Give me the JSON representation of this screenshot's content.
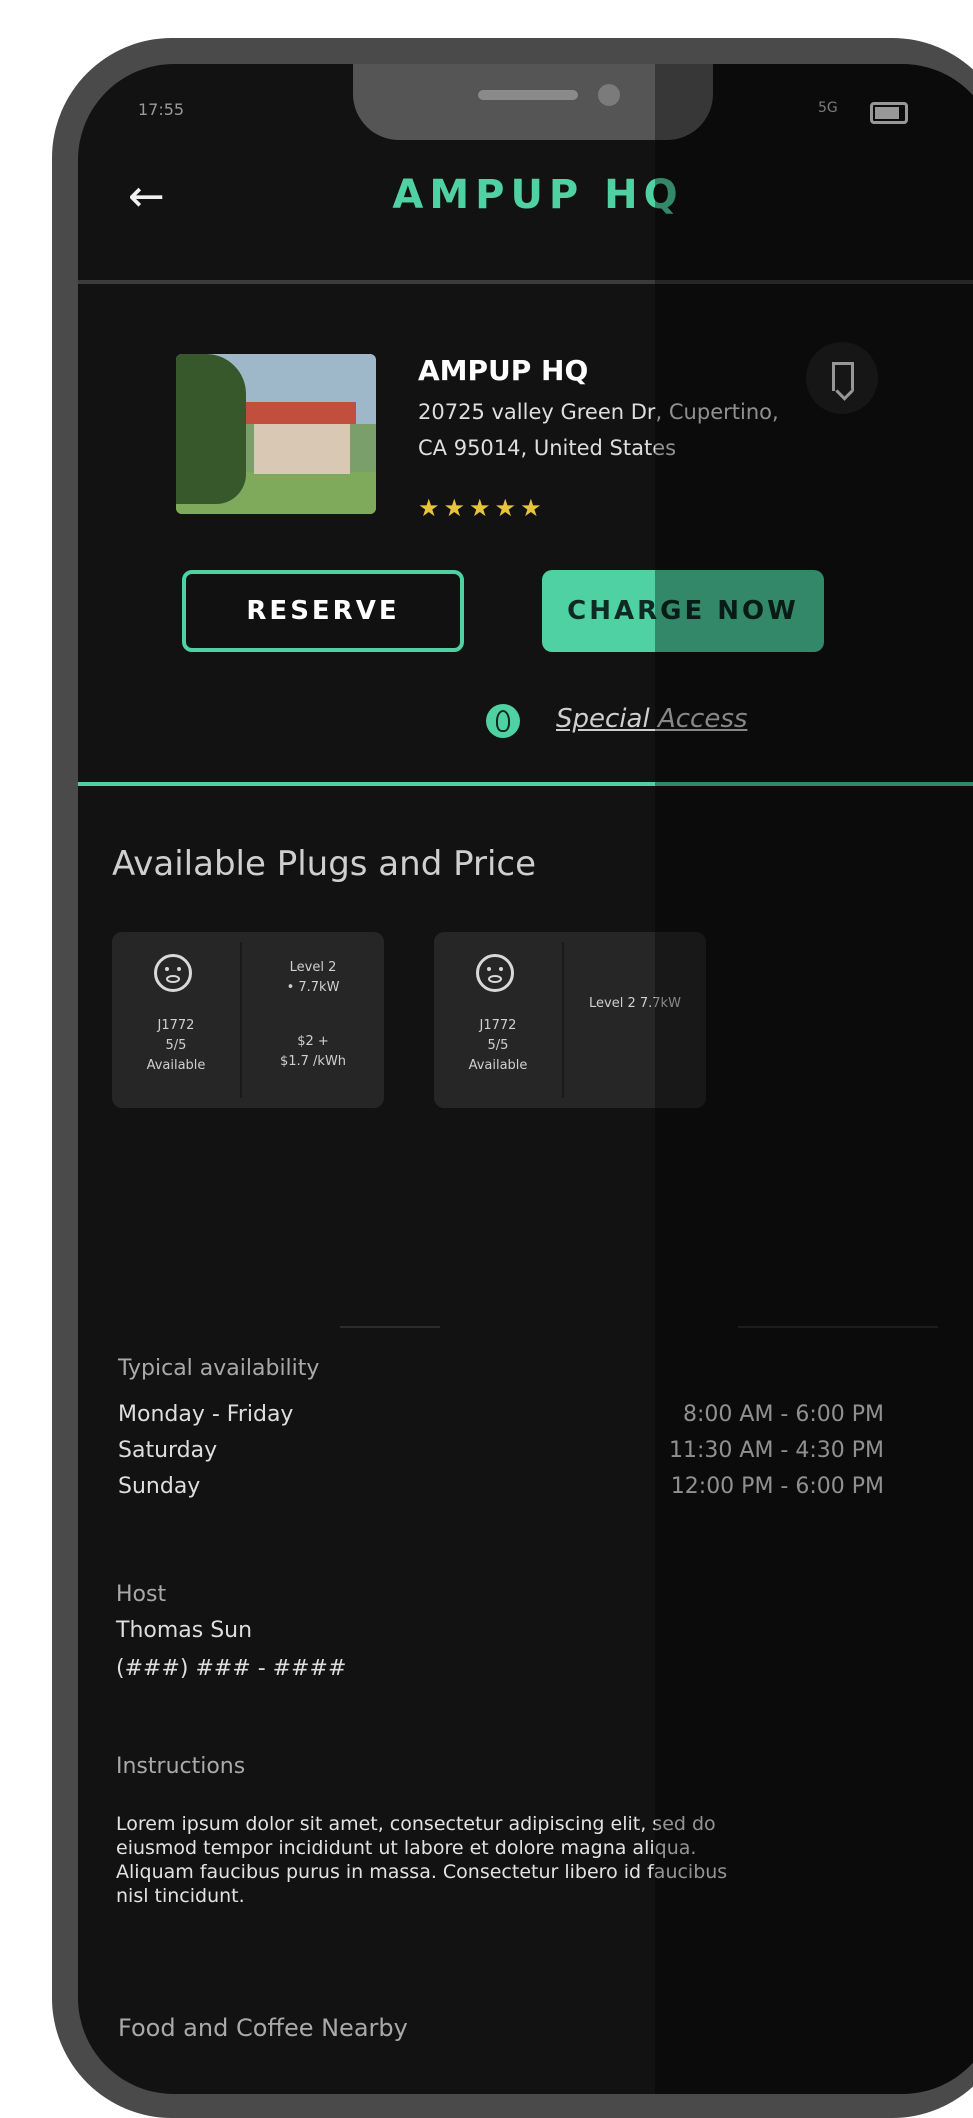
{
  "status_bar": {
    "time": "17:55",
    "signal": "5G"
  },
  "header": {
    "title": "AMPUP HQ"
  },
  "station": {
    "name": "AMPUP HQ",
    "address": "20725 valley Green Dr, Cupertino, CA 95014, United States",
    "rating_stars": "★★★★★",
    "rating_value": 5
  },
  "actions": {
    "reserve_label": "RESERVE",
    "charge_label": "CHARGE NOW",
    "special_access_label": "Special Access"
  },
  "plugs": {
    "section_title": "Available Plugs and Price",
    "items": [
      {
        "connector": "J1772",
        "availability": "5/5",
        "status": "Available",
        "level": "Level 2",
        "power": "• 7.7kW",
        "price_line1": "$2 +",
        "price_line2": "$1.7 /kWh"
      },
      {
        "connector": "J1772",
        "availability": "5/5",
        "status": "Available",
        "level_power": "Level 2 7.7kW"
      }
    ]
  },
  "availability": {
    "label": "Typical availability",
    "rows": [
      {
        "day": "Monday - Friday",
        "hours": "8:00 AM - 6:00 PM"
      },
      {
        "day": "Saturday",
        "hours": "11:30 AM - 4:30 PM"
      },
      {
        "day": "Sunday",
        "hours": "12:00 PM - 6:00 PM"
      }
    ]
  },
  "host": {
    "label": "Host",
    "name": "Thomas Sun",
    "phone": "(###) ### - ####"
  },
  "instructions": {
    "label": "Instructions",
    "text": "Lorem ipsum dolor sit amet, consectetur adipiscing elit, sed do eiusmod tempor incididunt ut labore et dolore magna aliqua. Aliquam faucibus purus in massa. Consectetur libero id faucibus nisl tincidunt."
  },
  "food": {
    "label": "Food and Coffee Nearby"
  },
  "colors": {
    "accent": "#4fd1a4",
    "background": "#121212",
    "star": "#e8c43a"
  }
}
